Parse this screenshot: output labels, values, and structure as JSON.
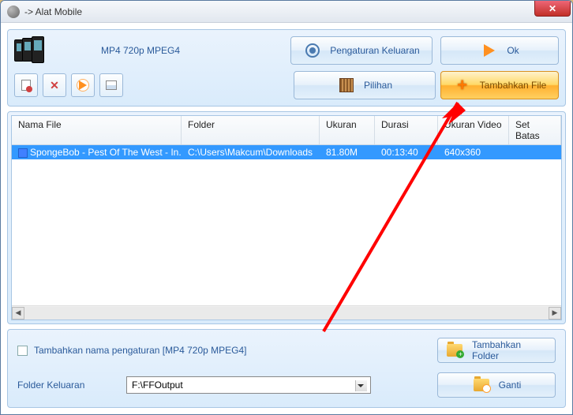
{
  "window": {
    "title": "-> Alat Mobile"
  },
  "top": {
    "format": "MP4 720p MPEG4",
    "settings_btn": "Pengaturan Keluaran",
    "ok_btn": "Ok",
    "options_btn": "Pilihan",
    "add_file_btn": "Tambahkan File"
  },
  "table": {
    "headers": {
      "name": "Nama File",
      "folder": "Folder",
      "size": "Ukuran",
      "duration": "Durasi",
      "dim": "Ukuran Video",
      "batas": "Set Batas"
    },
    "rows": [
      {
        "name": "SpongeBob - Pest Of The West - In...",
        "folder": "C:\\Users\\Makcum\\Downloads",
        "size": "81.80M",
        "duration": "00:13:40",
        "dim": "640x360",
        "batas": ""
      }
    ]
  },
  "bottom": {
    "checkbox_label": "Tambahkan nama pengaturan [MP4 720p MPEG4]",
    "add_folder_btn": "Tambahkan Folder",
    "output_label": "Folder Keluaran",
    "output_path": "F:\\FFOutput",
    "change_btn": "Ganti"
  }
}
